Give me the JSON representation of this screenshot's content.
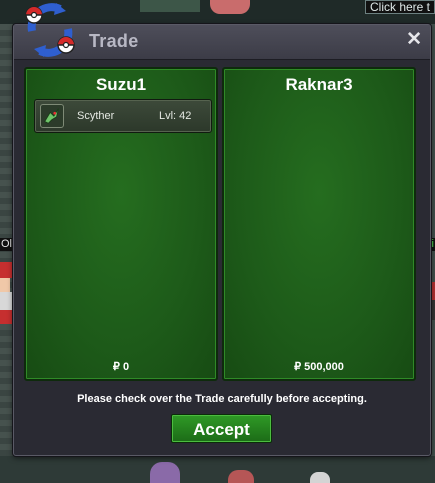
{
  "background": {
    "hint_text": "Click here t",
    "side_label_left": "Ol",
    "side_label_right": "i"
  },
  "window": {
    "title": "Trade",
    "close_glyph": "✕",
    "logo_icon": "pokeball-swap-icon"
  },
  "trade": {
    "left": {
      "player": "Suzu1",
      "items": [
        {
          "icon": "scyther-icon",
          "name": "Scyther",
          "level": "Lvl: 42"
        }
      ],
      "money": "₽ 0"
    },
    "right": {
      "player": "Raknar3",
      "items": [],
      "money": "₽ 500,000"
    }
  },
  "footer": {
    "notice": "Please check over the Trade carefully before accepting.",
    "accept_label": "Accept"
  },
  "colors": {
    "panel_green": "#1d5a19",
    "accept_green": "#2f9a26",
    "window_bg": "#2a2a33"
  }
}
